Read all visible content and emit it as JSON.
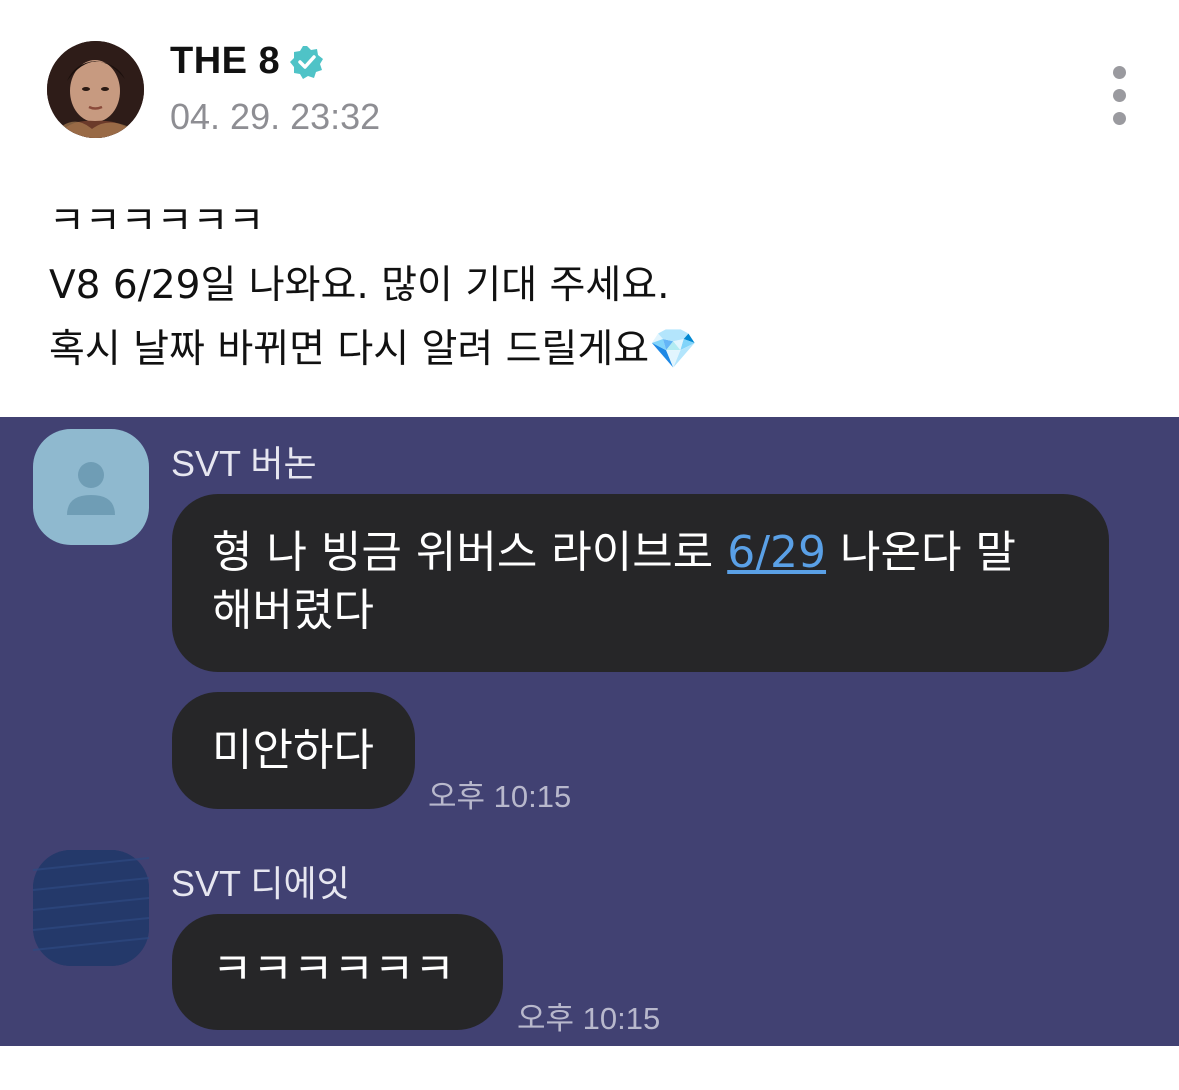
{
  "post": {
    "author": "THE 8",
    "date": "04. 29. 23:32",
    "lines": [
      "ㅋㅋㅋㅋㅋㅋ",
      "V8 6/29일 나와요. 많이 기대 주세요.",
      "혹시 날짜 바뀌면 다시 알려 드릴게요"
    ],
    "emoji": "💎"
  },
  "chat": {
    "messages": [
      {
        "sender": "SVT 버논",
        "text_before": "형 나 빙금 위버스 라이브로 ",
        "link": "6/29",
        "text_after": " 나온다 말",
        "line2": "해버렸다",
        "followup": "미안하다",
        "time": "오후 10:15"
      },
      {
        "sender": "SVT 디에잇",
        "text": "ㅋㅋㅋㅋㅋㅋ",
        "time": "오후 10:15"
      }
    ]
  },
  "colors": {
    "chat_background": "#414172",
    "bubble": "#262628",
    "link": "#5aa0e6",
    "verified": "#4fc3c7"
  }
}
